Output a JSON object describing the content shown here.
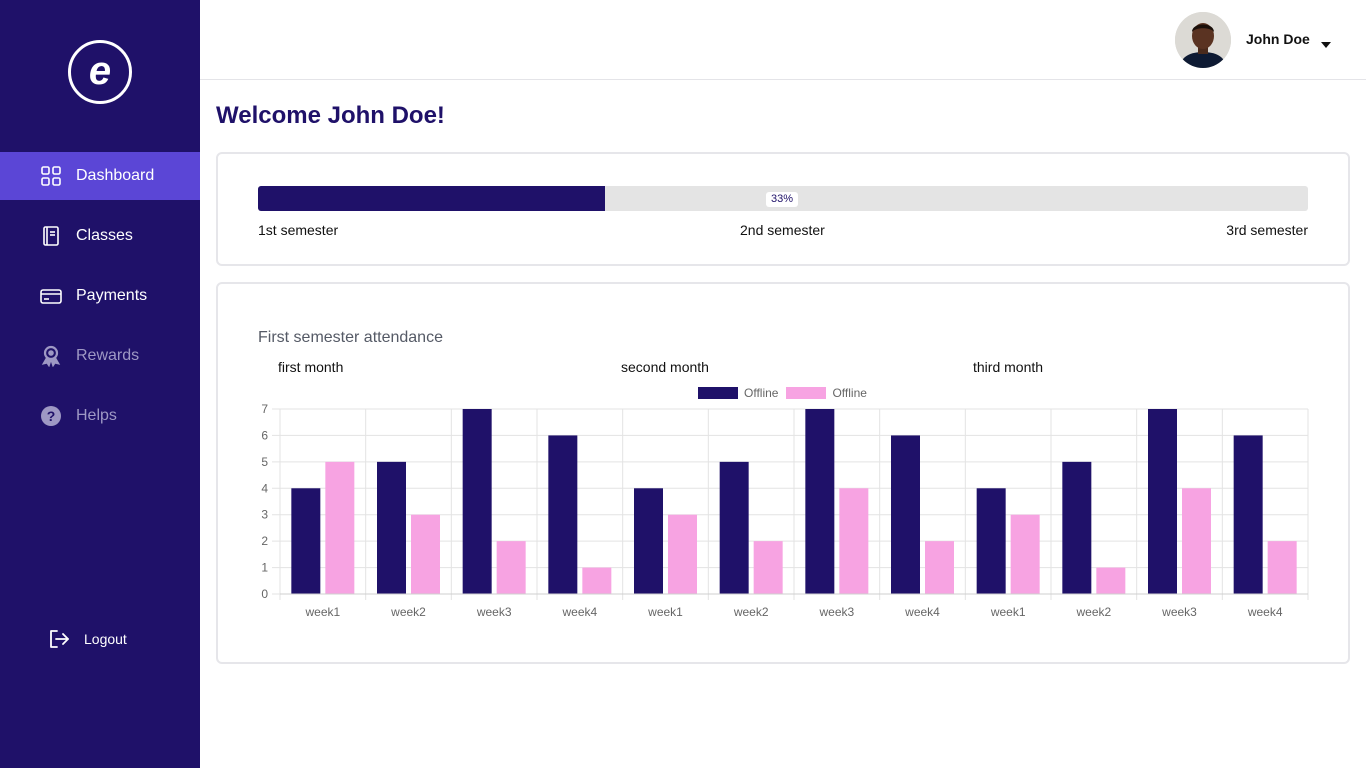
{
  "sidebar": {
    "logo_letter": "e",
    "items": [
      {
        "label": "Dashboard",
        "icon": "grid-icon"
      },
      {
        "label": "Classes",
        "icon": "book-icon"
      },
      {
        "label": "Payments",
        "icon": "card-icon"
      },
      {
        "label": "Rewards",
        "icon": "award-icon"
      },
      {
        "label": "Helps",
        "icon": "help-icon"
      }
    ],
    "logout_label": "Logout"
  },
  "header": {
    "user_name": "John Doe"
  },
  "welcome": "Welcome John Doe!",
  "progress": {
    "percent_label": "33%",
    "value": 0.33,
    "semesters": [
      "1st semester",
      "2nd semester",
      "3rd semester"
    ]
  },
  "colors": {
    "sidebar_bg": "#1f1169",
    "active_bg": "#5b46d6",
    "series_dark": "#1f1169",
    "series_pink": "#f7a3e2"
  },
  "chart_data": {
    "type": "bar",
    "title": "First semester attendance",
    "groups": [
      "first month",
      "second month",
      "third month"
    ],
    "categories": [
      "week1",
      "week2",
      "week3",
      "week4",
      "week1",
      "week2",
      "week3",
      "week4",
      "week1",
      "week2",
      "week3",
      "week4"
    ],
    "series": [
      {
        "name": "Offline",
        "color": "#1f1169",
        "values": [
          4,
          5,
          7,
          6,
          4,
          5,
          7,
          6,
          4,
          5,
          7,
          6
        ]
      },
      {
        "name": "Offline",
        "color": "#f7a3e2",
        "values": [
          5,
          3,
          2,
          1,
          3,
          2,
          4,
          2,
          3,
          1,
          4,
          2
        ]
      }
    ],
    "ylim": [
      0,
      7
    ],
    "yticks": [
      0,
      1,
      2,
      3,
      4,
      5,
      6,
      7
    ],
    "grid": true,
    "legend": "top-center"
  }
}
